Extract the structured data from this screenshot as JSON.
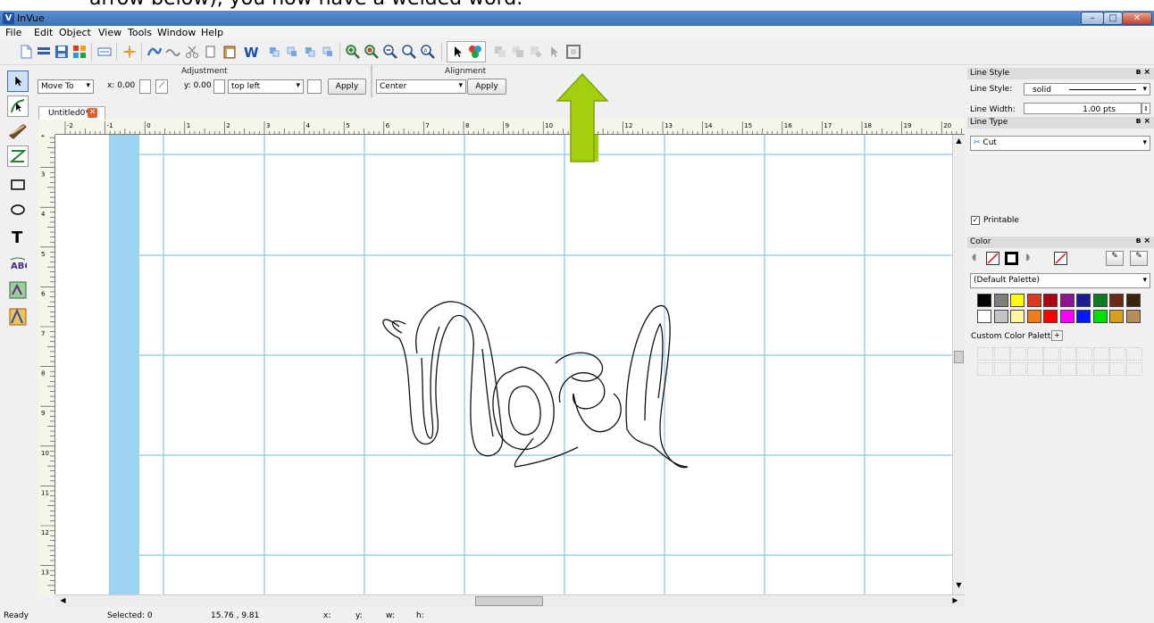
{
  "caption_fragment": "arrow below), you now have a welded word.",
  "window": {
    "title": "InVue",
    "app_icon_letter": "V",
    "minimize_label": "–",
    "maximize_label": "□",
    "close_label": "✕"
  },
  "menu": [
    "File",
    "Edit",
    "Object",
    "View",
    "Tools",
    "Window",
    "Help"
  ],
  "adjustment": {
    "group_label": "Adjustment",
    "mode_value": "Move To",
    "x_label": "x: 0.00",
    "y_label": "y: 0.00",
    "anchor_value": "top left",
    "apply_label": "Apply"
  },
  "alignment": {
    "group_label": "Alignment",
    "align_value": "Center",
    "apply_label": "Apply"
  },
  "document_tab": {
    "label": "Untitled0*",
    "close_label": "✕"
  },
  "rulers": {
    "horizontal_ticks": [
      "-2",
      "-1",
      "0",
      "1",
      "2",
      "3",
      "4",
      "5",
      "6",
      "7",
      "8",
      "9",
      "10",
      "11",
      "12",
      "13",
      "14",
      "15",
      "16",
      "17",
      "18",
      "19",
      "20"
    ],
    "vertical_ticks": [
      "2",
      "3",
      "4",
      "5",
      "6",
      "7",
      "8",
      "9",
      "10",
      "11",
      "12",
      "13"
    ]
  },
  "line_style_panel": {
    "title": "Line Style",
    "style_label": "Line Style:",
    "style_value": "solid",
    "width_label": "Line Width:",
    "width_value": "1.00 pts"
  },
  "line_type_panel": {
    "title": "Line Type",
    "type_value": "Cut",
    "printable_label": "Printable",
    "printable_checked": true
  },
  "color_panel": {
    "title": "Color",
    "palette_value": "(Default Palette)",
    "custom_label": "Custom Color Palette",
    "row1": [
      "#000000",
      "#7f7f7f",
      "#ffff00",
      "#e03a1e",
      "#b00016",
      "#8e1490",
      "#1c1c8e",
      "#0e7a24",
      "#6b2a18",
      "#3a2410"
    ],
    "row2": [
      "#ffffff",
      "#c3c3c3",
      "#fff7a0",
      "#f07c1a",
      "#ff0000",
      "#ff00ff",
      "#0018ff",
      "#00e000",
      "#d4a020",
      "#b88c5c"
    ]
  },
  "panel_float_icon": "ʙ ×",
  "status": {
    "state": "Ready",
    "selected": "Selected: 0",
    "coords": "15.76 , 9.81",
    "x": "x:",
    "y": "y:",
    "w": "w:",
    "h": "h:"
  },
  "canvas_content": {
    "word": "Noel",
    "accent_color": "#a3cf0c",
    "grid_color": "#9fd0ea",
    "margin_color": "#9cd4ef"
  }
}
